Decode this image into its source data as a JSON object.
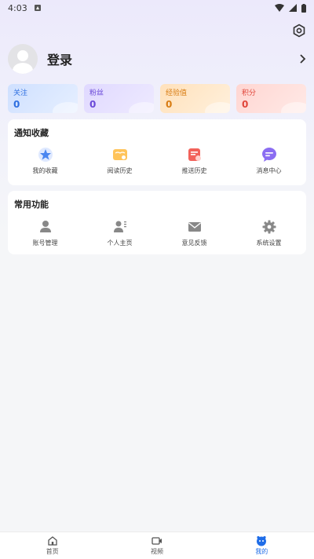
{
  "statusbar": {
    "time": "4:03"
  },
  "profile": {
    "login_label": "登录"
  },
  "stats": [
    {
      "label": "关注",
      "value": "0"
    },
    {
      "label": "粉丝",
      "value": "0"
    },
    {
      "label": "经验值",
      "value": "0"
    },
    {
      "label": "积分",
      "value": "0"
    }
  ],
  "notify_section": {
    "title": "通知收藏",
    "items": [
      {
        "label": "我的收藏",
        "icon": "star-icon"
      },
      {
        "label": "阅读历史",
        "icon": "book-icon"
      },
      {
        "label": "推送历史",
        "icon": "calendar-icon"
      },
      {
        "label": "消息中心",
        "icon": "chat-icon"
      }
    ]
  },
  "common_section": {
    "title": "常用功能",
    "items": [
      {
        "label": "账号管理",
        "icon": "person-icon"
      },
      {
        "label": "个人主页",
        "icon": "profile-card-icon"
      },
      {
        "label": "意见反馈",
        "icon": "mail-icon"
      },
      {
        "label": "系统设置",
        "icon": "gear-icon"
      }
    ]
  },
  "bottom_nav": [
    {
      "label": "首页",
      "icon": "home-icon"
    },
    {
      "label": "视频",
      "icon": "video-icon"
    },
    {
      "label": "我的",
      "icon": "mine-icon"
    }
  ],
  "colors": {
    "accent": "#1f6de8"
  }
}
